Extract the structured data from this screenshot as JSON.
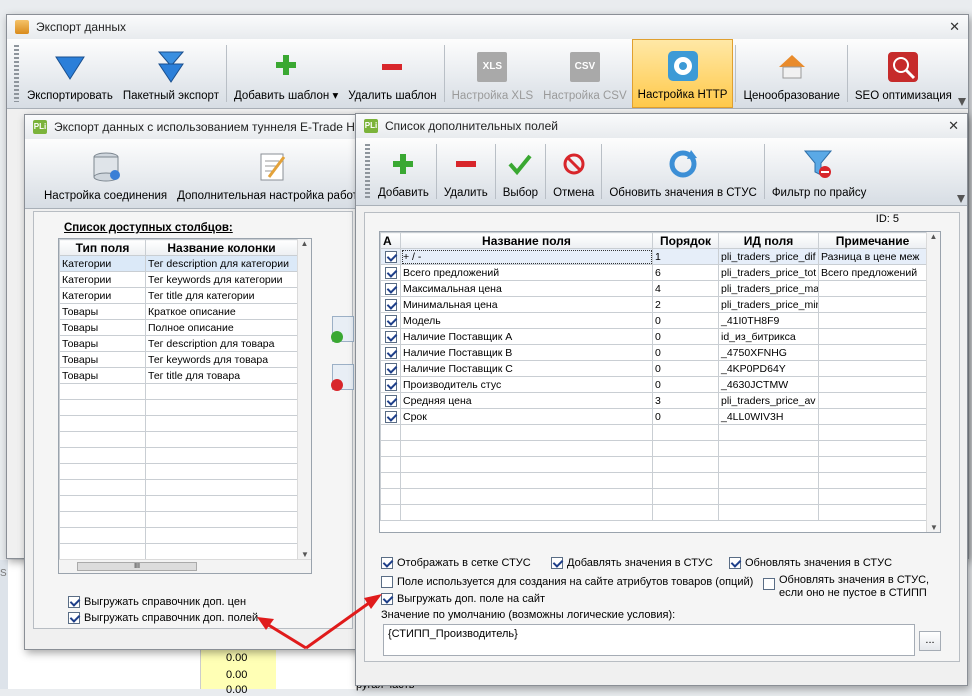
{
  "bg": {
    "cells": [
      "0.00",
      "0.00",
      "0.00"
    ],
    "side": "S",
    "bottom_text": "ругая часть"
  },
  "main": {
    "title": "Экспорт данных",
    "close": "✕",
    "toolbar": [
      {
        "label": "Экспортировать",
        "icon": "arrow-down-icon"
      },
      {
        "label": "Пакетный экспорт",
        "icon": "double-arrow-down-icon"
      },
      {
        "label": "Добавить шаблон ▾",
        "icon": "plus-icon"
      },
      {
        "label": "Удалить шаблон",
        "icon": "minus-icon"
      },
      {
        "label": "Настройка XLS",
        "icon": "xls-icon",
        "badge": "XLS"
      },
      {
        "label": "Настройка CSV",
        "icon": "csv-icon",
        "badge": "CSV"
      },
      {
        "label": "Настройка HTTP",
        "icon": "http-icon"
      },
      {
        "label": "Ценообразование",
        "icon": "house-icon"
      },
      {
        "label": "SEO оптимизация",
        "icon": "globe-search-icon"
      }
    ]
  },
  "tunnel": {
    "title": "Экспорт данных с использованием туннеля E-Trade HTTP",
    "toolbar": [
      {
        "label": "Настройка соединения",
        "icon": "database-icon"
      },
      {
        "label": "Дополнительная настройка работы",
        "icon": "notepad-icon"
      }
    ],
    "list_title": "Список доступных столбцов:",
    "columns": [
      "Тип поля",
      "Название колонки"
    ],
    "rows": [
      [
        "Категории",
        "Тег description для категории"
      ],
      [
        "Категории",
        "Тег keywords для категории"
      ],
      [
        "Категории",
        "Тег title для категории"
      ],
      [
        "Товары",
        "Краткое описание"
      ],
      [
        "Товары",
        "Полное описание"
      ],
      [
        "Товары",
        "Тег description для товара"
      ],
      [
        "Товары",
        "Тег keywords для товара"
      ],
      [
        "Товары",
        "Тег title для товара"
      ]
    ],
    "scroll_grip": "III",
    "checks": [
      {
        "label": "Выгружать справочник доп. цен",
        "checked": true
      },
      {
        "label": "Выгружать справочник доп. полей",
        "checked": true
      }
    ]
  },
  "fields": {
    "title": "Список дополнительных полей",
    "close": "✕",
    "toolbar": [
      {
        "label": "Добавить",
        "icon": "plus-icon"
      },
      {
        "label": "Удалить",
        "icon": "minus-icon"
      },
      {
        "label": "Выбор",
        "icon": "check-icon"
      },
      {
        "label": "Отмена",
        "icon": "cancel-icon"
      },
      {
        "label": "Обновить значения в СТУС",
        "icon": "refresh-icon"
      },
      {
        "label": "Фильтр по прайсу",
        "icon": "filter-icon"
      }
    ],
    "id_label": "ID: 5",
    "columns": [
      "А",
      "Название поля",
      "Порядок",
      "ИД поля",
      "Примечание"
    ],
    "rows": [
      [
        "+ / -",
        "1",
        "pli_traders_price_dif",
        "Разница в цене меж"
      ],
      [
        "Всего предложений",
        "6",
        "pli_traders_price_tot",
        "Всего предложений"
      ],
      [
        "Максимальная цена",
        "4",
        "pli_traders_price_ma",
        ""
      ],
      [
        "Минимальная цена",
        "2",
        "pli_traders_price_mir",
        ""
      ],
      [
        "Модель",
        "0",
        "_41I0TH8F9",
        ""
      ],
      [
        "Наличие Поставщик А",
        "0",
        "id_из_битрикса",
        ""
      ],
      [
        "Наличие Поставщик В",
        "0",
        "_4750XFNHG",
        ""
      ],
      [
        "Наличие Поставщик С",
        "0",
        "_4KP0PD64Y",
        ""
      ],
      [
        "Производитель стус",
        "0",
        "_4630JCTMW",
        ""
      ],
      [
        "Средняя цена",
        "3",
        "pli_traders_price_av",
        ""
      ],
      [
        "Срок",
        "0",
        "_4LL0WIV3H",
        ""
      ]
    ],
    "opts": [
      {
        "label": "Отображать в сетке СТУС",
        "checked": true
      },
      {
        "label": "Добавлять значения в СТУС",
        "checked": true
      },
      {
        "label": "Обновлять значения в СТУС",
        "checked": true
      },
      {
        "label": "Поле используется для создания на сайте атрибутов товаров (опций)",
        "checked": false
      },
      {
        "label": "Обновлять значения в СТУС,",
        "label2": "если оно не пустое в СТИПП",
        "checked": false
      },
      {
        "label": "Выгружать доп. поле на сайт",
        "checked": true
      }
    ],
    "default_label": "Значение по умолчанию (возможны логические условия):",
    "default_value": "{СТИПП_Производитель}",
    "ellipsis": "..."
  },
  "colors": {
    "arrow": "#e01b1b",
    "accent": "#ffc94a"
  }
}
